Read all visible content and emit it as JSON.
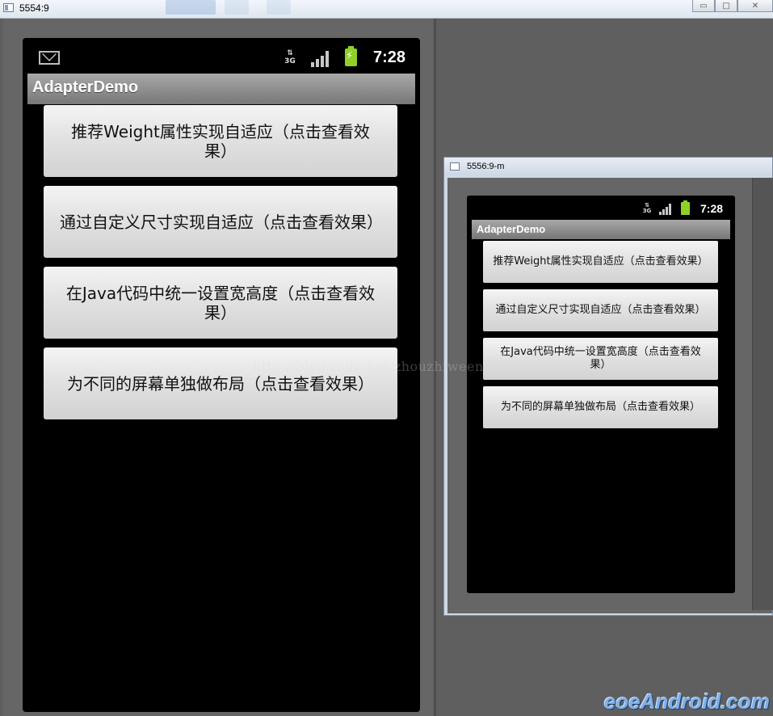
{
  "main_window": {
    "title": "5554:9",
    "controls": {
      "minimize": "▭",
      "maximize": "□",
      "close": "✕"
    }
  },
  "phone": {
    "clock": "7:28",
    "network": "3G",
    "app_title": "AdapterDemo",
    "buttons": [
      "推荐Weight属性实现自适应（点击查看效果）",
      "通过自定义尺寸实现自适应（点击查看效果）",
      "在Java代码中统一设置宽高度（点击查看效果）",
      "为不同的屏幕单独做布局（点击查看效果）"
    ]
  },
  "popup_window": {
    "title": "5556:9-m",
    "clock": "7:28",
    "network": "3G",
    "app_title": "AdapterDemo",
    "buttons": [
      "推荐Weight属性实现自适应（点击查看效果）",
      "通过自定义尺寸实现自适应（点击查看效果）",
      "在Java代码中统一设置宽高度（点击查看效果）",
      "为不同的屏幕单独做布局（点击查看效果）"
    ]
  },
  "watermark": "http://blog.csdn.net/zhouzhiweengang",
  "brand": "eoeAndroid.com",
  "icons": [
    "mail-icon",
    "signal-3g-icon",
    "signal-bars-icon",
    "battery-charging-icon"
  ],
  "colors": {
    "battery": "#8fd127",
    "appbar": "#8e8e8e",
    "button": "#e2e2e2",
    "screen": "#000000"
  }
}
